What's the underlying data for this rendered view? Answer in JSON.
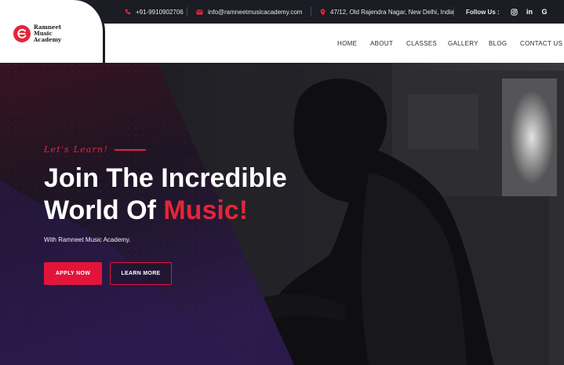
{
  "topbar": {
    "phone": "+91-9910902706",
    "email": "info@ramneetmusicacademy.com",
    "address": "47/12, Old Rajendra Nagar, New Delhi, India",
    "follow_label": "Follow Us :",
    "social": [
      {
        "name": "instagram-icon",
        "glyph": "◎"
      },
      {
        "name": "linkedin-icon",
        "glyph": "in"
      },
      {
        "name": "google-icon",
        "glyph": "G"
      }
    ]
  },
  "logo": {
    "line1": "Ramneet",
    "line2": "Music",
    "line3": "Academy"
  },
  "nav": {
    "items": [
      "HOME",
      "ABOUT",
      "CLASSES",
      "GALLERY",
      "BLOG",
      "CONTACT US"
    ]
  },
  "hero": {
    "subtitle": "Let's Learn!",
    "headline_line1": "Join The Incredible",
    "headline_line2_prefix": "World Of",
    "headline_line2_accent": "Music!",
    "tagline": "With Ramneet Music Academy.",
    "primary_button": "APPLY NOW",
    "secondary_button": "LEARN MORE"
  },
  "colors": {
    "accent": "#e3263a",
    "topbar_bg": "#1b1c24",
    "nav_bg": "#ffffff",
    "hero_overlay_red": "#6b1124",
    "hero_overlay_purple": "#2c1a4e"
  }
}
